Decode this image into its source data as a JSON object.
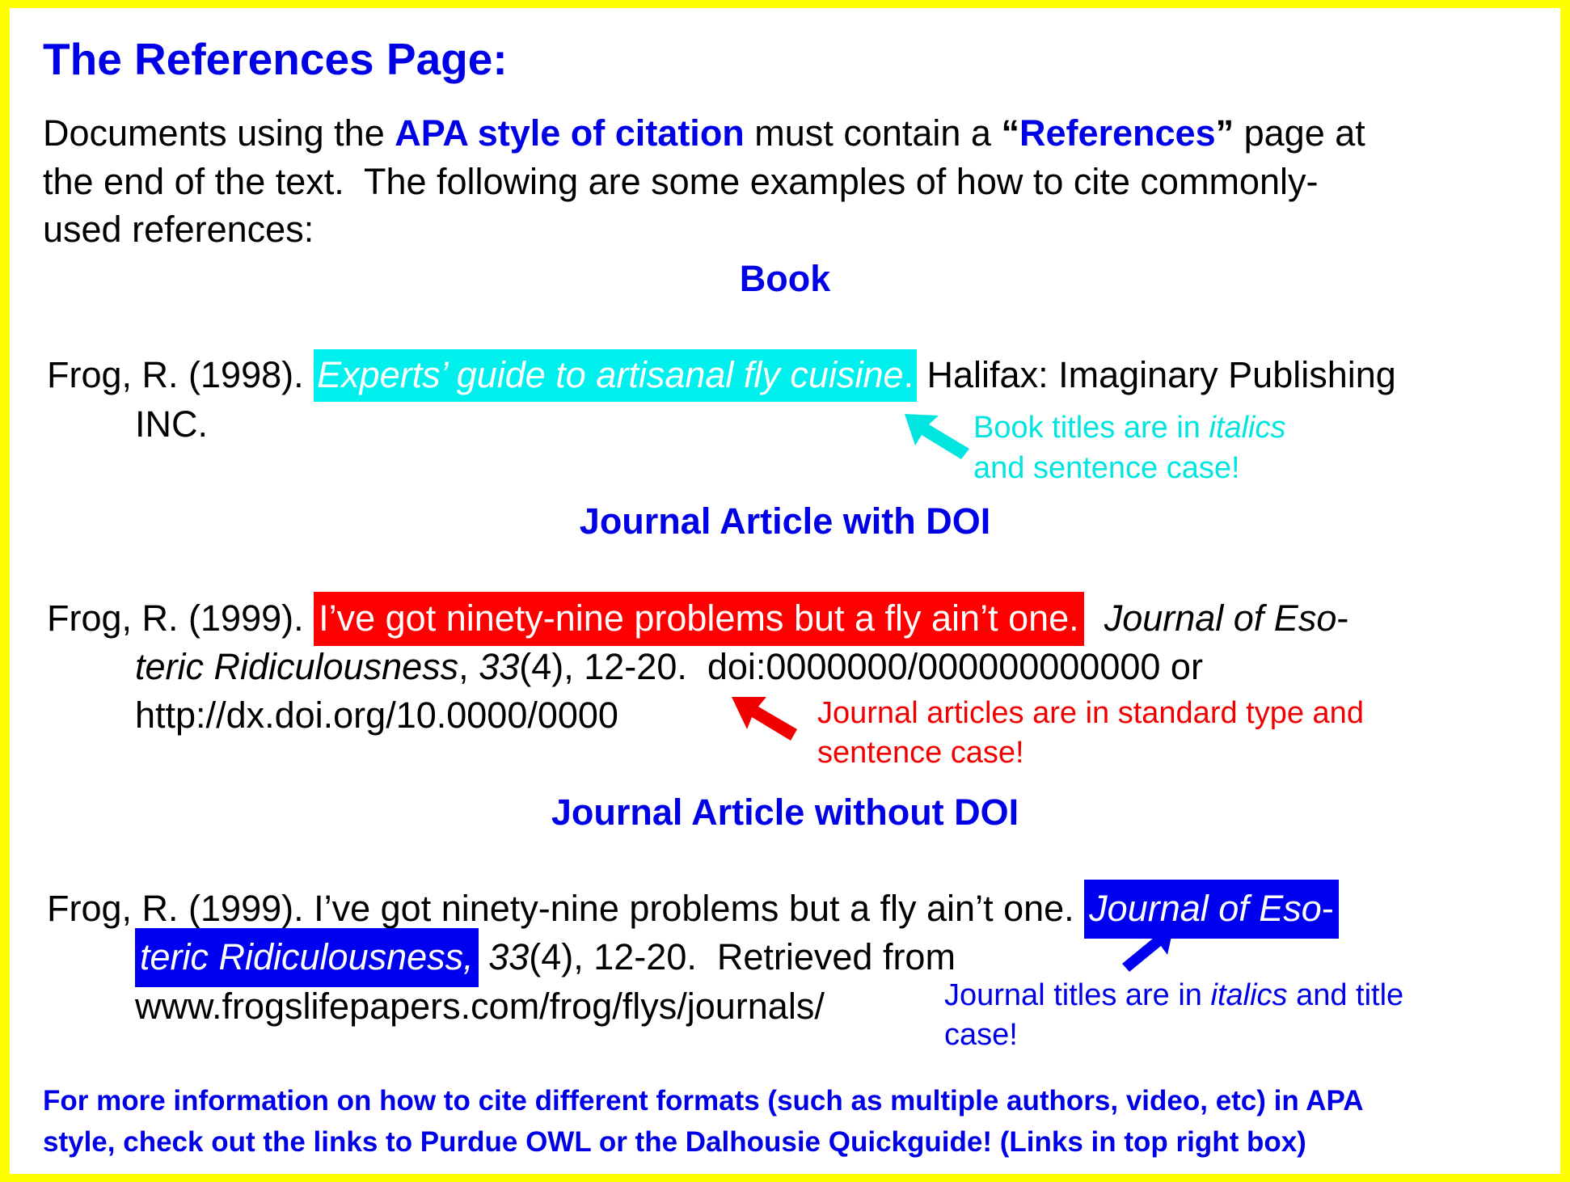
{
  "title": "The References Page:",
  "intro": {
    "line1_pre": "Documents using the ",
    "line1_em": "APA style of citation",
    "line1_mid": " must contain a ",
    "line1_open_quote": "“",
    "line1_quoted": "References",
    "line1_close_quote": "”",
    "line1_post": " page at",
    "line2": "the end of the text.  The following are some examples of how to cite commonly-",
    "line3": "used references:"
  },
  "sections": {
    "book": {
      "heading": "Book",
      "line1_author": "Frog, R. (1998). ",
      "line1_title": "Experts’ guide to artisanal fly cuisine",
      "line1_title_period": ".",
      "line1_post": " Halifax: Imaginary Publishing",
      "line2": "INC.",
      "note_line1_pre": "Book titles are in ",
      "note_line1_em": "italics",
      "note_line2": "and sentence case!"
    },
    "journal_doi": {
      "heading": "Journal Article with DOI",
      "line1_author": "Frog, R. (1999). ",
      "line1_article": "I’ve got ninety-nine problems but a fly ain’t one.",
      "line1_journal": "Journal of Eso",
      "line1_hyphen": "-",
      "line2_journal": "teric Ridiculousness",
      "line2_comma": ", ",
      "line2_volume": "33",
      "line2_rest": "(4), 12-20.  doi:0000000/000000000000 or",
      "line3": "http://dx.doi.org/10.0000/0000",
      "note_line1": "Journal articles are in standard type and",
      "note_line2": "sentence case!"
    },
    "journal_no_doi": {
      "heading": "Journal Article without DOI",
      "line1_pre": "Frog, R. (1999). I’ve got ninety-nine problems but a fly ain’t one. ",
      "line1_journal": "Journal of Eso",
      "line1_hyphen": "-",
      "line2_journal": "teric Ridiculousness,",
      "line2_volume": "33",
      "line2_rest": "(4), 12-20.  Retrieved from",
      "line3": "www.frogslifepapers.com/frog/flys/journals/",
      "note_line1_pre": "Journal titles are in ",
      "note_line1_em": "italics",
      "note_line1_post": " and title",
      "note_line2": "case!"
    }
  },
  "footer": {
    "line1": "For more information on how to cite different formats (such as multiple authors, video, etc) in APA",
    "line2": "style, check out the links to Purdue OWL or the Dalhousie Quickguide! (Links in top right box)"
  },
  "colors": {
    "border": "#ffff00",
    "accent_blue": "#0000e6",
    "book_highlight": "#00f0ee",
    "article_highlight": "#ff0000",
    "journal_highlight": "#0000f0"
  },
  "icons": {
    "book_note_arrow": "arrow-up-left",
    "doi_note_arrow": "arrow-up-left",
    "journal_note_arrow": "arrow-up-right"
  }
}
